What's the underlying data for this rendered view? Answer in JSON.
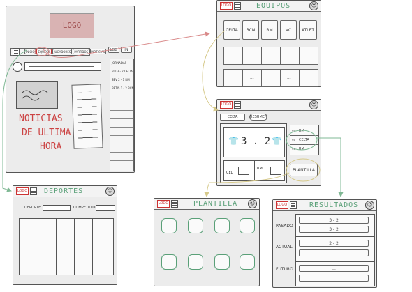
{
  "home": {
    "logo": "LOGO",
    "nav": [
      "INICIO",
      "EQUIPOS",
      "JUGADORES",
      "PARTIDOS",
      "NOTICIAS"
    ],
    "login_buttons": [
      "LOG",
      "IN"
    ],
    "side_list": [
      "JORNADAS",
      "BTI 3 - 2 CELTA",
      "SEV 2 - 1 RM",
      "BETIS 1 - 2 BCN"
    ],
    "headline_lines": [
      "NOTICIAS",
      "DE ULTIMA",
      "HORA"
    ]
  },
  "equipos": {
    "logo": "LOGO",
    "title": "EQUIPOS",
    "teams": [
      "CELTA",
      "BCN",
      "RM",
      "VC",
      "ATLET"
    ],
    "placeholder": "..."
  },
  "partido": {
    "logo": "LOGO",
    "filters": [
      "CELTA",
      "RESUMEN"
    ],
    "score": "3 . 2",
    "side_items": [
      "RM",
      "CELTA",
      "RM"
    ],
    "side_prefix": "vs",
    "plantilla_button": "PLANTILLA",
    "bottom_labels": [
      "CEL",
      "RM"
    ]
  },
  "deportes": {
    "logo": "LOGO",
    "title": "DEPORTES",
    "filter_1": "DEPORTE",
    "filter_2": "COMPETICION"
  },
  "plantilla": {
    "logo": "LOGO",
    "title": "PLANTILLA"
  },
  "resultados": {
    "logo": "LOGO",
    "title": "RESULTADOS",
    "rows": [
      {
        "label": "PASADO",
        "values": [
          "3 - 2",
          "3 - 2"
        ]
      },
      {
        "label": "ACTUAL",
        "values": [
          "2 - 2",
          "..."
        ]
      },
      {
        "label": "FUTURO",
        "values": [
          "...",
          "..."
        ]
      }
    ]
  },
  "colors": {
    "frame_bg": "#ececec",
    "logo_red": "#cc3333",
    "title_green": "#5aa078",
    "arrow_red": "#d98a8a",
    "arrow_yellow": "#d6c98a",
    "arrow_green": "#7fb894"
  }
}
